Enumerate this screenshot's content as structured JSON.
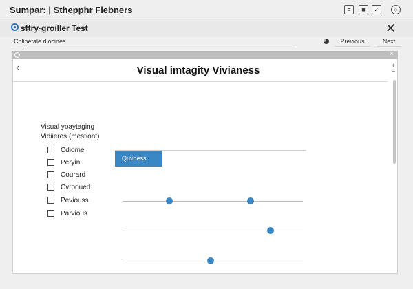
{
  "window": {
    "title": "Sumpar: | Sthepphr Fiebners"
  },
  "app": {
    "title": "sftry·groiller Test"
  },
  "nav": {
    "breadcrumb": "Cnlipetale diocines",
    "previous_label": "Previous",
    "next_label": "Next"
  },
  "panel": {
    "close_glyph": "×",
    "back_glyph": "‹",
    "heading": "Visual imtagity Vivianess",
    "menu_glyph": "+\n=\n"
  },
  "filters": {
    "title": "Visual yoaytaging",
    "subtitle": "Vidiieres (mestiont)",
    "options": [
      {
        "label": "Cdiome",
        "checked": false
      },
      {
        "label": "Peryin",
        "checked": false
      },
      {
        "label": "Courard",
        "checked": false
      },
      {
        "label": "Cvrooued",
        "checked": false
      },
      {
        "label": "Peviouss",
        "checked": false
      },
      {
        "label": "Parvious",
        "checked": false
      }
    ]
  },
  "action": {
    "button_label": "Quvhess"
  },
  "sliders": [
    {
      "values": [
        0.26,
        0.71
      ]
    },
    {
      "values": [
        0.82
      ]
    },
    {
      "values": [
        0.49
      ]
    }
  ],
  "colors": {
    "accent": "#3a87c6"
  }
}
